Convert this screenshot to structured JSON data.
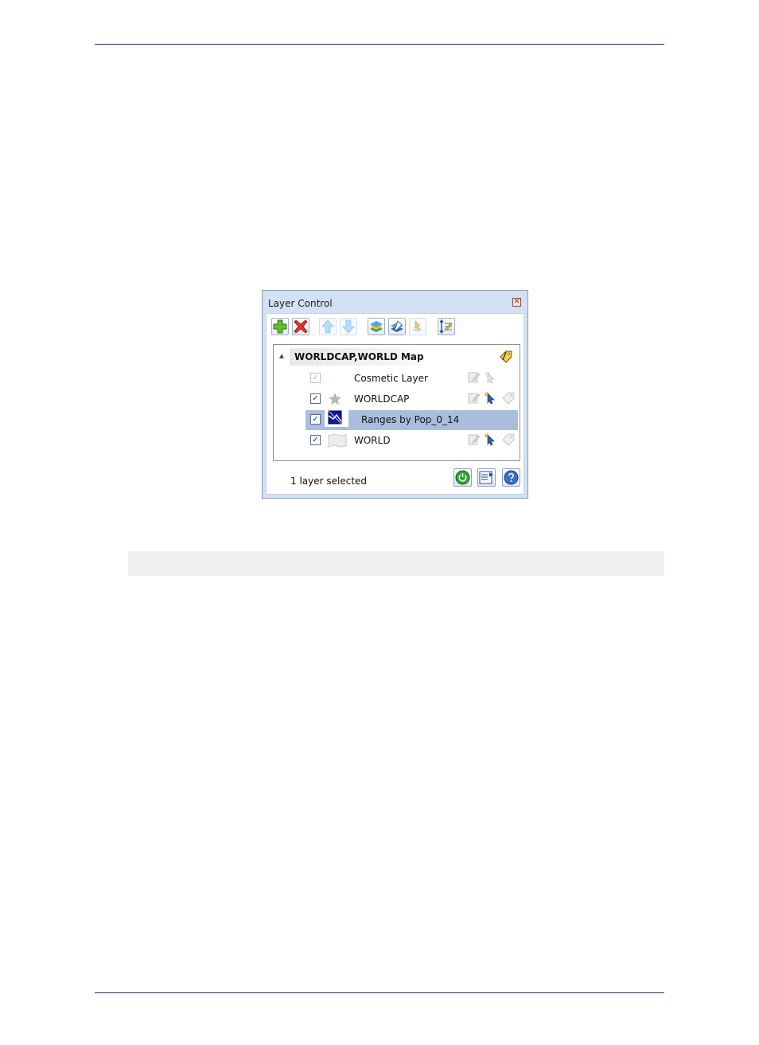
{
  "window": {
    "title": "Layer Control",
    "close_symbol": "✕"
  },
  "toolbar": {
    "buttons": [
      {
        "icon": "add-layer-icon",
        "enabled": true
      },
      {
        "icon": "remove-layer-icon",
        "enabled": true
      },
      {
        "icon": "move-up-icon",
        "enabled": false
      },
      {
        "icon": "move-down-icon",
        "enabled": false
      },
      {
        "icon": "layer-properties-icon",
        "enabled": true
      },
      {
        "icon": "edit-layer-icon",
        "enabled": true
      },
      {
        "icon": "selectable-icon",
        "enabled": false
      },
      {
        "icon": "reorder-icon",
        "enabled": true
      }
    ]
  },
  "tree": {
    "map_title": "WORLDCAP,WORLD Map",
    "layers": [
      {
        "name": "Cosmetic Layer",
        "checked": true,
        "enabled": false,
        "icon": "none"
      },
      {
        "name": "WORLDCAP",
        "checked": true,
        "enabled": true,
        "icon": "star-icon"
      },
      {
        "name": "Ranges by Pop_0_14",
        "checked": true,
        "enabled": true,
        "icon": "theme-ranges-icon",
        "selected": true
      },
      {
        "name": "WORLD",
        "checked": true,
        "enabled": true,
        "icon": "region-icon"
      }
    ],
    "check_symbol": "✓"
  },
  "status": {
    "text": "1 layer selected"
  },
  "colors": {
    "window_bg": "#d2e1f3",
    "selection": "#a8bedc",
    "rule": "#1f2f6e"
  }
}
